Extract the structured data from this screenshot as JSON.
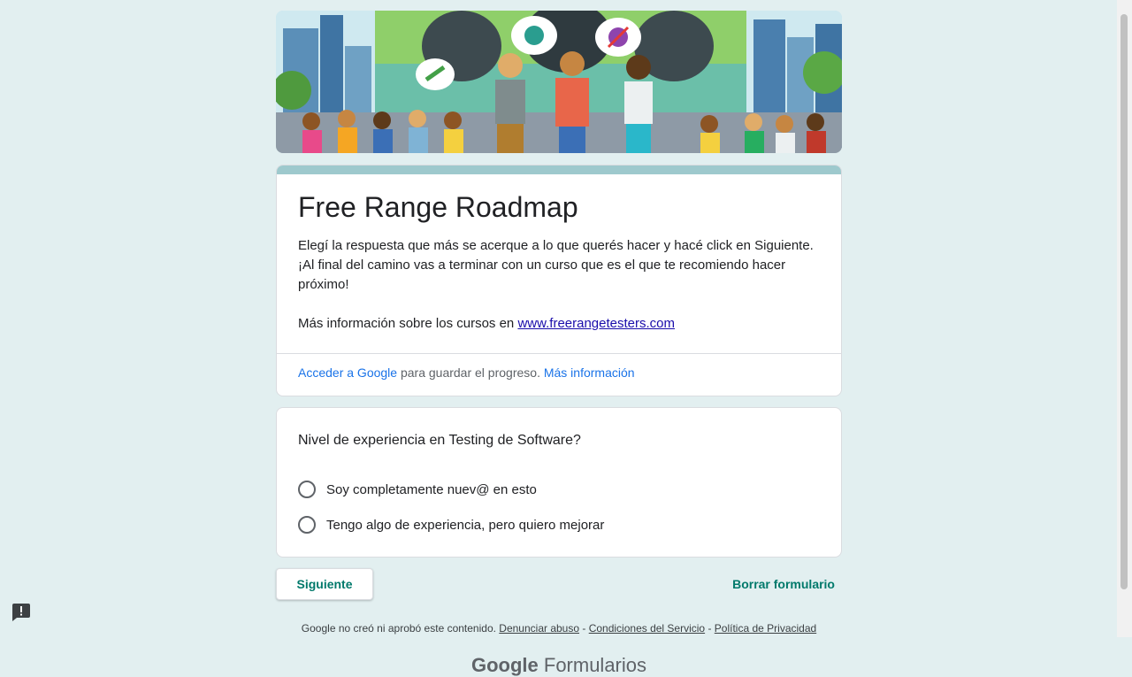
{
  "form": {
    "title": "Free Range Roadmap",
    "description_line": "Elegí la respuesta que más se acerque a lo que querés hacer y hacé click en Siguiente. ¡Al final del camino vas a terminar con un curso que es el que te recomiendo hacer próximo!",
    "info_prefix": "Más información sobre los cursos en ",
    "info_link": "www.freerangetesters.com"
  },
  "signin": {
    "link": "Acceder a Google",
    "middle": " para guardar el progreso. ",
    "more": "Más información"
  },
  "question": {
    "title": "Nivel de experiencia en Testing de Software?",
    "options": [
      "Soy completamente nuev@ en esto",
      "Tengo algo de experiencia, pero quiero mejorar"
    ]
  },
  "nav": {
    "next_label": "Siguiente",
    "clear_label": "Borrar formulario"
  },
  "footer": {
    "disclaimer": "Google no creó ni aprobó este contenido.",
    "report_abuse": "Denunciar abuso",
    "terms": "Condiciones del Servicio",
    "privacy": "Política de Privacidad",
    "sep": " - "
  },
  "brand": {
    "google": "Google",
    "forms": "Formularios"
  },
  "colors": {
    "page_bg": "#e2eff0",
    "accent": "#00796b",
    "title_bar": "#9ec9cd",
    "link_blue": "#1a73e8"
  },
  "icons": [
    "report-problem-icon"
  ]
}
